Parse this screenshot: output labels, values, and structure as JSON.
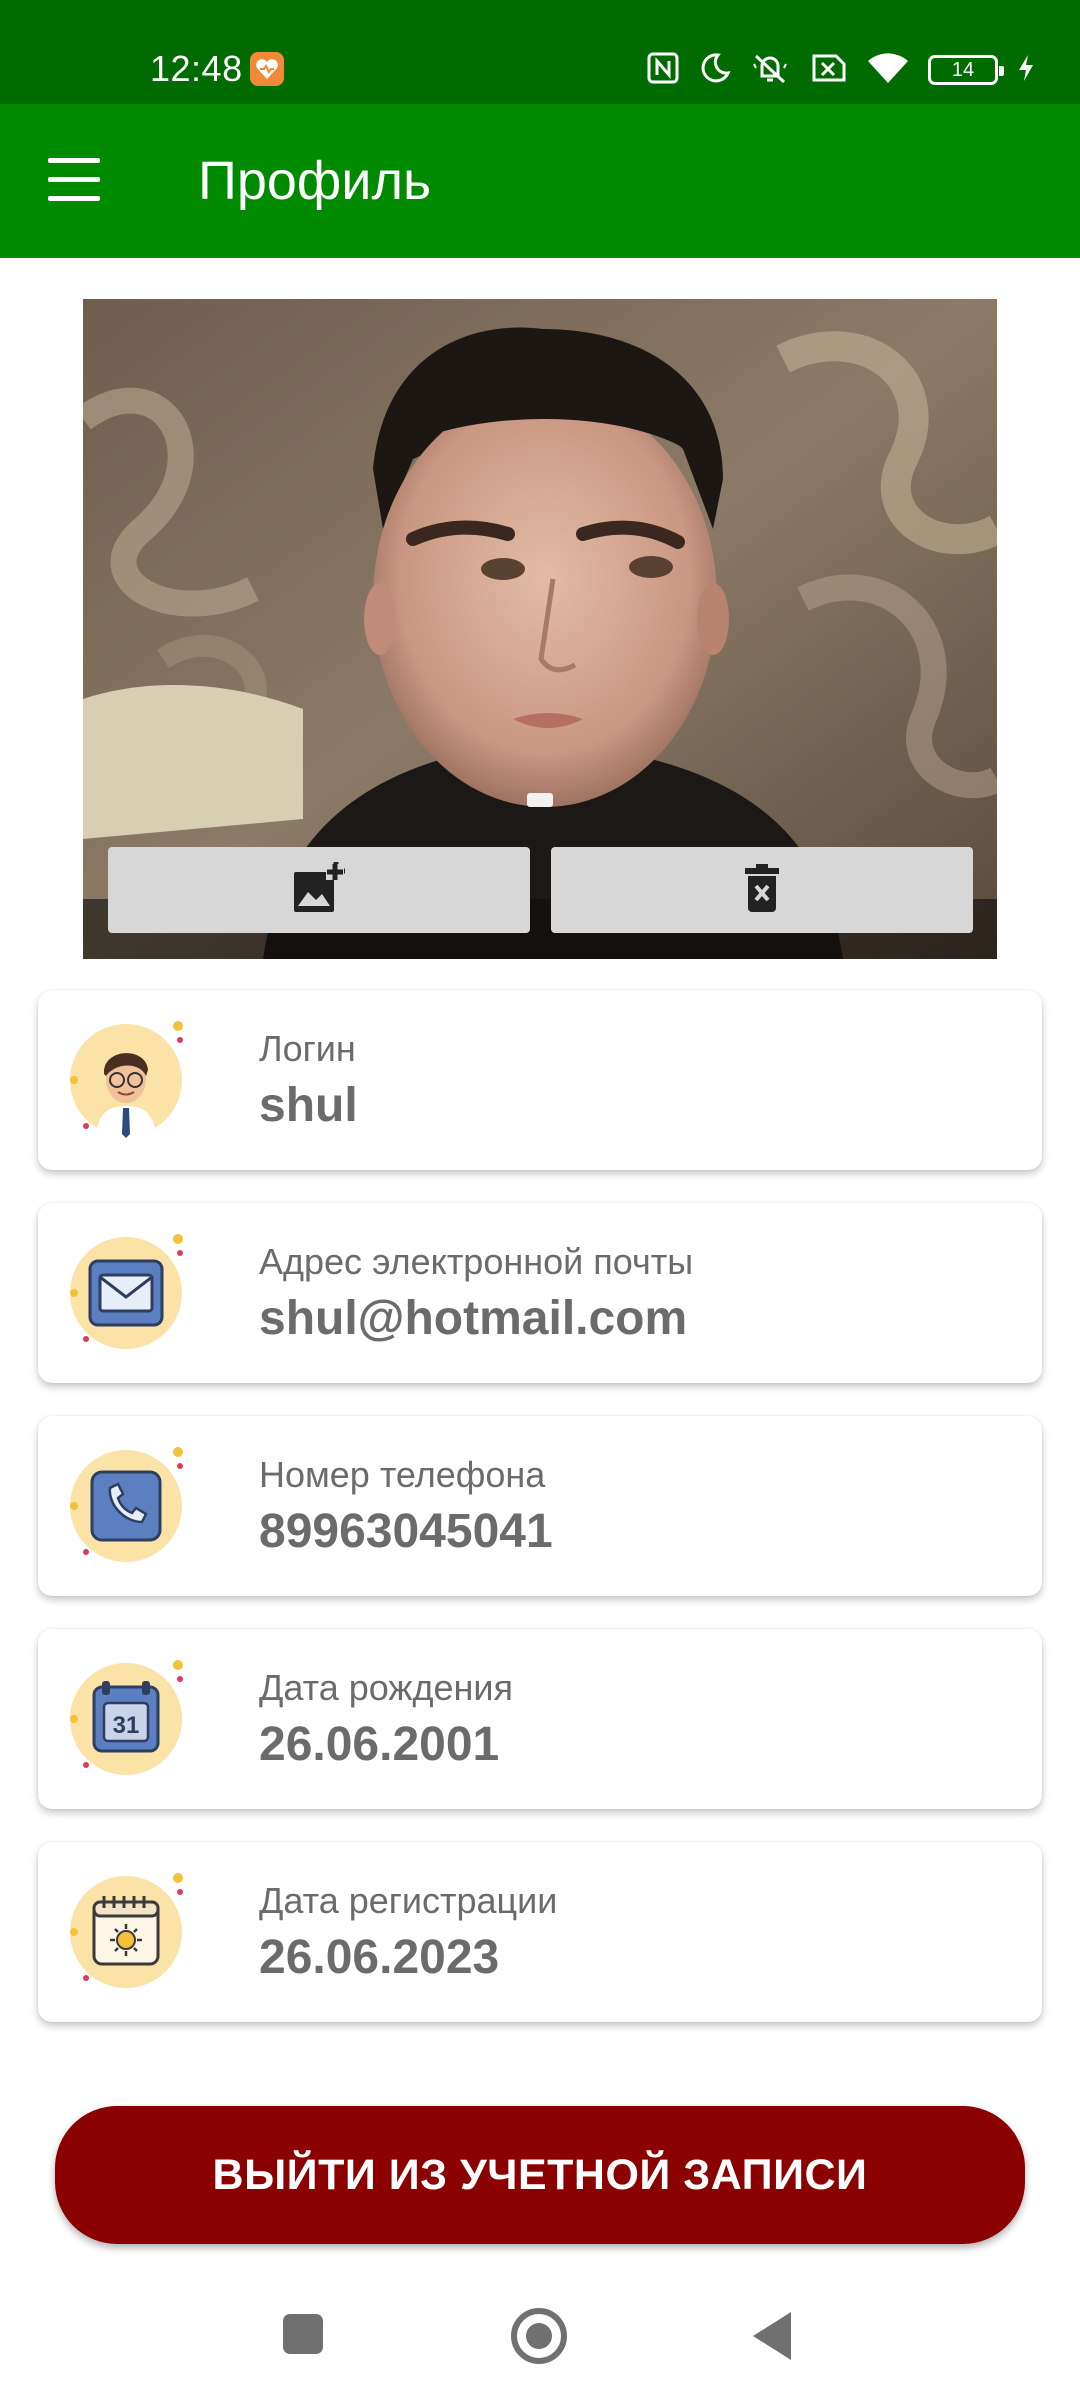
{
  "status_bar": {
    "time": "12:48",
    "battery_level": "14",
    "icons": [
      "health-app-icon",
      "nfc-icon",
      "do-not-disturb-icon",
      "vibrate-off-icon",
      "no-sim-icon",
      "wifi-icon",
      "battery-icon",
      "charging-icon"
    ]
  },
  "app_bar": {
    "title": "Профиль",
    "menu_icon": "hamburger-menu-icon",
    "color": "#008a00"
  },
  "profile_photo": {
    "add_icon": "add-photo-icon",
    "delete_icon": "delete-icon"
  },
  "cards": [
    {
      "label": "Логин",
      "value": "shul",
      "icon": "user-avatar-icon"
    },
    {
      "label": "Адрес электронной почты",
      "value": "shul@hotmail.com",
      "icon": "envelope-icon"
    },
    {
      "label": "Номер телефона",
      "value": "89963045041",
      "icon": "phone-icon"
    },
    {
      "label": "Дата рождения",
      "value": "26.06.2001",
      "icon": "calendar-icon",
      "calendar_day": "31"
    },
    {
      "label": "Дата регистрации",
      "value": "26.06.2023",
      "icon": "calendar-sun-icon"
    }
  ],
  "logout_button": {
    "label": "ВЫЙТИ ИЗ УЧЕТНОЙ ЗАПИСИ",
    "color": "#8b0000"
  },
  "nav_bar": {
    "icons": [
      "recent-apps-icon",
      "home-icon",
      "back-icon"
    ]
  }
}
